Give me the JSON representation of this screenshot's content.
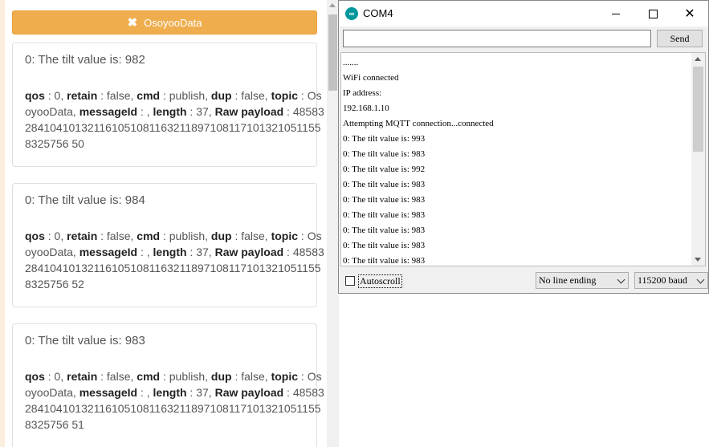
{
  "left_panel": {
    "topic_close_glyph": "✖",
    "topic_label": "OsoyooData",
    "messages": [
      {
        "title": "0: The tilt value is: 982",
        "qos_key": "qos",
        "qos_val": " : 0, ",
        "retain_key": "retain",
        "retain_val": " : false, ",
        "cmd_key": "cmd",
        "cmd_val": " : publish, ",
        "dup_key": "dup",
        "dup_val": " : false, ",
        "topic_key": "topic",
        "topic_val": " : OsoyooData, ",
        "msgid_key": "messageId",
        "msgid_val": " : , ",
        "length_key": "length",
        "length_val": " : 37, ",
        "raw_key": "Raw payload",
        "raw_val": " : 485832841041013211610510811632118971081171013210511558325756 50"
      },
      {
        "title": "0: The tilt value is: 984",
        "qos_key": "qos",
        "qos_val": " : 0, ",
        "retain_key": "retain",
        "retain_val": " : false, ",
        "cmd_key": "cmd",
        "cmd_val": " : publish, ",
        "dup_key": "dup",
        "dup_val": " : false, ",
        "topic_key": "topic",
        "topic_val": " : OsoyooData, ",
        "msgid_key": "messageId",
        "msgid_val": " : , ",
        "length_key": "length",
        "length_val": " : 37, ",
        "raw_key": "Raw payload",
        "raw_val": " : 485832841041013211610510811632118971081171013210511558325756 52"
      },
      {
        "title": "0: The tilt value is: 983",
        "qos_key": "qos",
        "qos_val": " : 0, ",
        "retain_key": "retain",
        "retain_val": " : false, ",
        "cmd_key": "cmd",
        "cmd_val": " : publish, ",
        "dup_key": "dup",
        "dup_val": " : false, ",
        "topic_key": "topic",
        "topic_val": " : OsoyooData, ",
        "msgid_key": "messageId",
        "msgid_val": " : , ",
        "length_key": "length",
        "length_val": " : 37, ",
        "raw_key": "Raw payload",
        "raw_val": " : 485832841041013211610510811632118971081171013210511558325756 51"
      }
    ]
  },
  "serial_monitor": {
    "title": "COM4",
    "icon_glyph": "∞",
    "send_input_value": "",
    "send_label": "Send",
    "output_lines": [
      ".......",
      "WiFi connected",
      "IP address:",
      "192.168.1.10",
      "Attempting MQTT connection...connected",
      "0: The tilt value is: 993",
      "0: The tilt value is: 983",
      "0: The tilt value is: 992",
      "0: The tilt value is: 983",
      "0: The tilt value is: 983",
      "0: The tilt value is: 983",
      "0: The tilt value is: 983",
      "0: The tilt value is: 983",
      "0: The tilt value is: 983"
    ],
    "autoscroll_label": "Autoscroll",
    "line_ending": "No line ending",
    "baud_rate": "115200 baud",
    "close_glyph": "✕"
  }
}
